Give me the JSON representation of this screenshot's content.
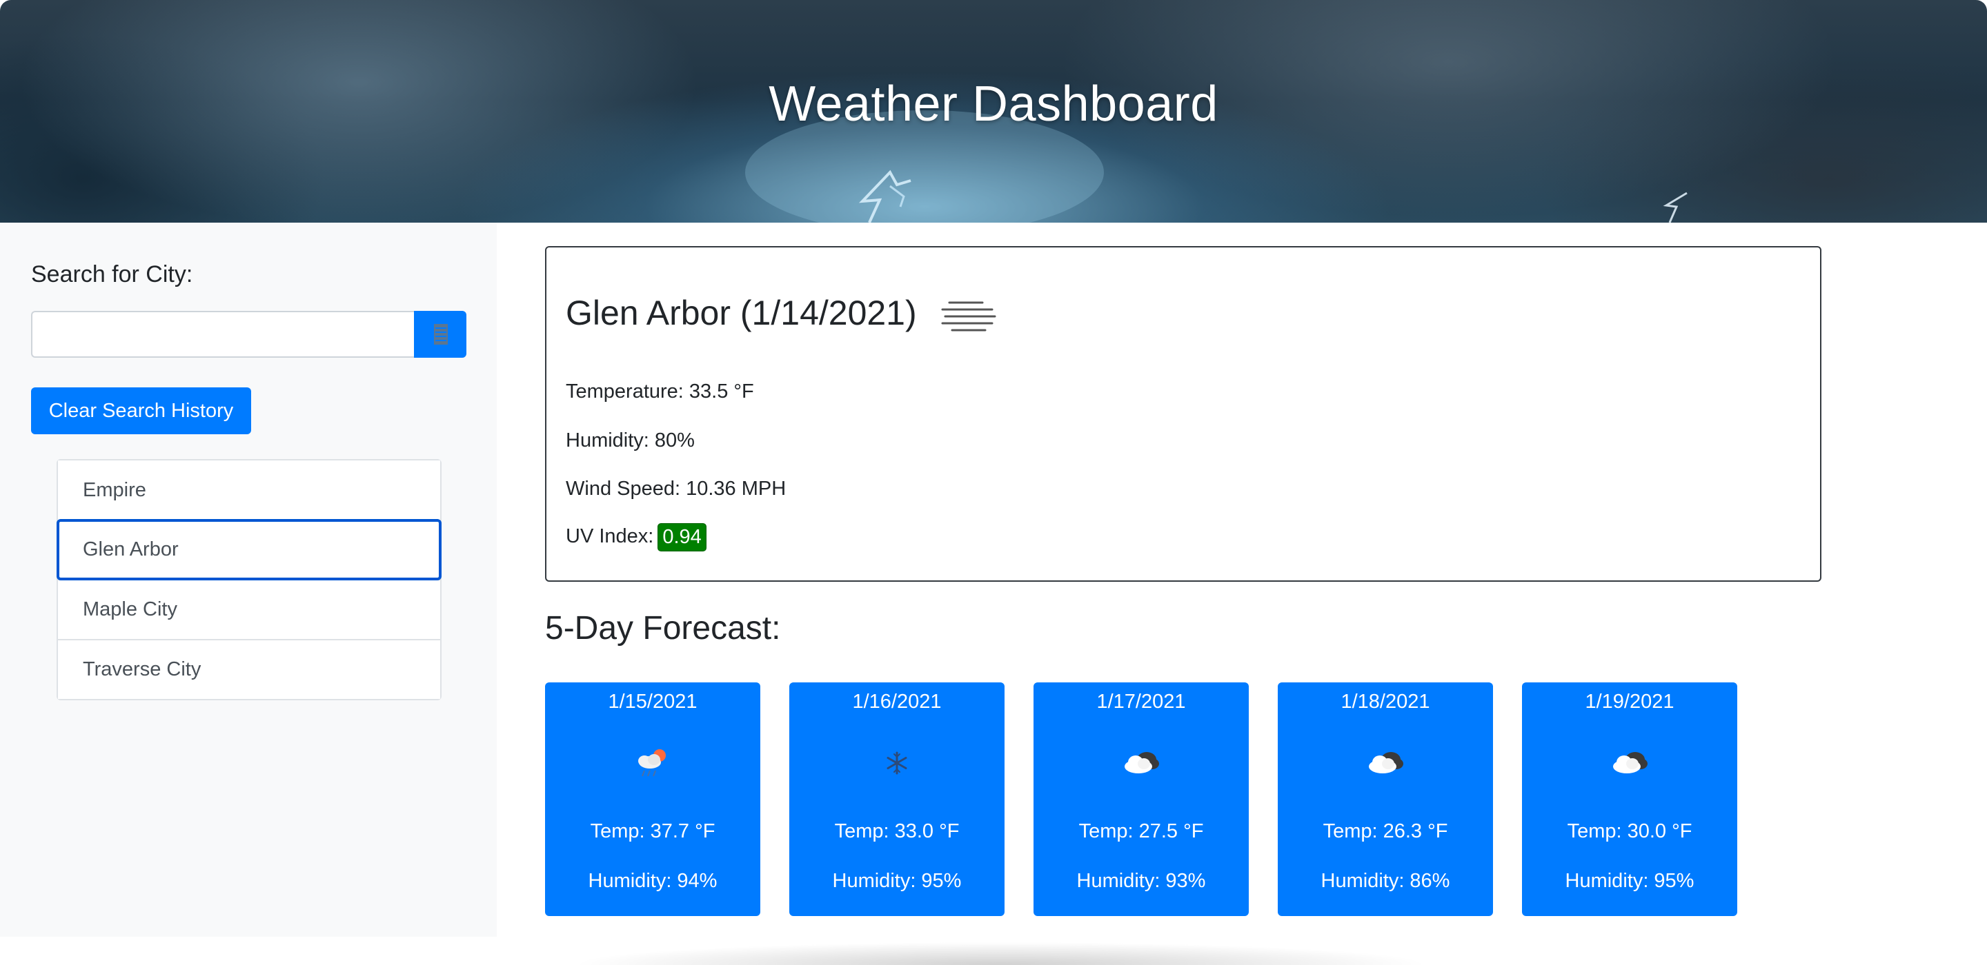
{
  "header": {
    "title": "Weather Dashboard"
  },
  "sidebar": {
    "search_label": "Search for City:",
    "search_input_value": "",
    "search_input_placeholder": "",
    "search_button_icon": "search-icon",
    "clear_button_label": "Clear Search History",
    "history": [
      {
        "label": "Empire",
        "active": false
      },
      {
        "label": "Glen Arbor",
        "active": true
      },
      {
        "label": "Maple City",
        "active": false
      },
      {
        "label": "Traverse City",
        "active": false
      }
    ]
  },
  "current": {
    "title": "Glen Arbor (1/14/2021)",
    "icon": "mist-icon",
    "temperature": "Temperature: 33.5 °F",
    "humidity": "Humidity: 80%",
    "wind": "Wind Speed: 10.36 MPH",
    "uv_label": "UV Index:",
    "uv_value": "0.94",
    "uv_color": "#008000"
  },
  "forecast": {
    "heading": "5-Day Forecast:",
    "days": [
      {
        "date": "1/15/2021",
        "icon": "rain-sun-icon",
        "temp": "Temp: 37.7 °F",
        "humidity": "Humidity: 94%"
      },
      {
        "date": "1/16/2021",
        "icon": "snow-icon",
        "temp": "Temp: 33.0 °F",
        "humidity": "Humidity: 95%"
      },
      {
        "date": "1/17/2021",
        "icon": "cloud-icon",
        "temp": "Temp: 27.5 °F",
        "humidity": "Humidity: 93%"
      },
      {
        "date": "1/18/2021",
        "icon": "cloud-icon",
        "temp": "Temp: 26.3 °F",
        "humidity": "Humidity: 86%"
      },
      {
        "date": "1/19/2021",
        "icon": "cloud-icon",
        "temp": "Temp: 30.0 °F",
        "humidity": "Humidity: 95%"
      }
    ]
  },
  "colors": {
    "accent": "#007bff",
    "sidebar_bg": "#f8f9fa",
    "active_border": "#0056d2"
  }
}
